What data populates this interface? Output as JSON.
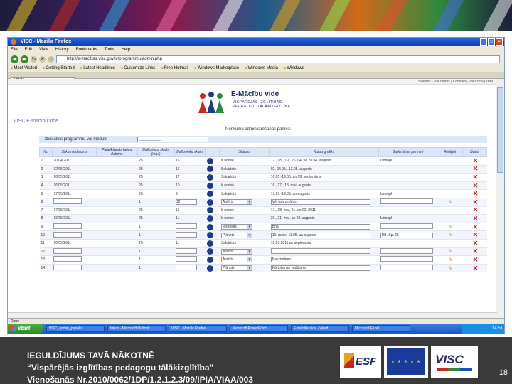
{
  "browser": {
    "window_title": "VISC - Mozilla Firefox",
    "menu": [
      "File",
      "Edit",
      "View",
      "History",
      "Bookmarks",
      "Tools",
      "Help"
    ],
    "url": "http://e-macibas.visc.gov.lv/programmu-admin.php",
    "bookmarks": [
      "Most Visited",
      "Getting Started",
      "Latest Headlines",
      "Customize Links",
      "Free Hotmail",
      "Windows Marketplace",
      "Windows Media",
      "Windows"
    ],
    "tab_label": "VISC",
    "status": "Done"
  },
  "page": {
    "site_nav": "Sākums | Par mums | Kontakti | Palīdzība | Iziet",
    "logo_title": "E-Mācību vide",
    "logo_subtitle_1": "VISPĀRĒJĀS IZGLĪTĪBAS",
    "logo_subtitle_2": "PEDAGOGU TĀLĀKIZGLĪTĪBA",
    "breadcrumb": "VISC E-mācību vide",
    "panel_title": "Norikumu administrēšanas panelis",
    "select_label": "Izvēlaties programmu vai moduli:",
    "select_value": "___________"
  },
  "table": {
    "headers": [
      "Nr.",
      "Sākuma datums",
      "Pieteikšanās beigu datums",
      "Dalībnieku skaits (max)",
      "Dalībnieku skaits",
      "",
      "Statuss",
      "Kursu grafiks",
      "Sadarbības partneri",
      "Rediģēt",
      "Dzēst"
    ],
    "rows": [
      {
        "nr": "1",
        "start": "20/04/2011",
        "deadline": "",
        "max": "25",
        "count": "16",
        "status": "Ir norisē",
        "schedule": "17., 18., 19., 26. 04. un 28.04. augusts",
        "partner": "Lmnopl",
        "edit": false
      },
      {
        "nr": "2",
        "start": "02/05/2011",
        "deadline": "",
        "max": "25",
        "count": "16",
        "status": "Sakārtots",
        "schedule": "02.-04.05., 12.05. augusts",
        "partner": "",
        "edit": false
      },
      {
        "nr": "3",
        "start": "16/05/2011",
        "deadline": "",
        "max": "25",
        "count": "17",
        "status": "Sakārtots",
        "schedule": "16.05.-19.05. un 18. septembris",
        "partner": "",
        "edit": false
      },
      {
        "nr": "4",
        "start": "16/05/2011",
        "deadline": "",
        "max": "25",
        "count": "10",
        "status": "Ir norisē",
        "schedule": "16., 17., 18. mai. augusts",
        "partner": "",
        "edit": false
      },
      {
        "nr": "5",
        "start": "17/05/2011",
        "deadline": "",
        "max": "25",
        "count": "9",
        "status": "Sakārtots",
        "schedule": "17.05.-19.05. un augusts",
        "partner": "Lmnopl",
        "edit": false
      },
      {
        "nr": "6",
        "start": "",
        "deadline": "",
        "max": "1",
        "count": "12",
        "status": "Atvērts",
        "schedule": "Vēl nav zināms",
        "partner": "",
        "edit": true
      },
      {
        "nr": "7",
        "start": "17/05/2011",
        "deadline": "",
        "max": "25",
        "count": "16",
        "status": "Ir norisē",
        "schedule": "17., 18. mai, 01. un 02. 2011",
        "partner": "",
        "edit": false
      },
      {
        "nr": "8",
        "start": "16/05/2011",
        "deadline": "",
        "max": "25",
        "count": "11",
        "status": "Ir norisē",
        "schedule": "20., 21. mai. un 22. augusts",
        "partner": "Lmnopl",
        "edit": false
      },
      {
        "nr": "9",
        "start": "",
        "deadline": "",
        "max": "17",
        "count": "",
        "status": "Iesniegts",
        "schedule": "Bņa",
        "partner": "",
        "edit": true
      },
      {
        "nr": "10",
        "start": "",
        "deadline": "",
        "max": "1",
        "count": "",
        "status": "Plānots",
        "schedule": "10. maijs, 11.05. un augusts",
        "partner": "DB. Sp. 65",
        "edit": true
      },
      {
        "nr": "11",
        "start": "16/05/2011",
        "deadline": "",
        "max": "25",
        "count": "11",
        "status": "Sakārtots",
        "schedule": "16.05.2011 un septembris",
        "partner": "",
        "edit": false
      },
      {
        "nr": "12",
        "start": "",
        "deadline": "",
        "max": "1",
        "count": "",
        "status": "Atvērts",
        "schedule": "",
        "partner": "",
        "edit": true
      },
      {
        "nr": "13",
        "start": "",
        "deadline": "",
        "max": "1",
        "count": "",
        "status": "Atvērts",
        "schedule": "Nav zināms",
        "partner": "",
        "edit": true
      },
      {
        "nr": "14",
        "start": "",
        "deadline": "",
        "max": "1",
        "count": "",
        "status": "Plānots",
        "schedule": "Kārtošanas vadīšana",
        "partner": "",
        "edit": true
      }
    ]
  },
  "taskbar": {
    "start": "start",
    "items": [
      "VISC_admin_panelis",
      "Inbox - Microsoft Outlook",
      "VISC - Mozilla Firefox",
      "Microsoft PowerPoint",
      "E-mācību vide - Word",
      "Microsoft Excel"
    ],
    "clock": "14:51"
  },
  "footer": {
    "line1": "IEGULDĪJUMS TAVĀ NĀKOTNĒ",
    "line2": "“Vispārējās izglītības pedagogu tālākizglītība”",
    "line3": "Vienošanās Nr.2010/0062/1DP/1.2.1.2.3/09/IPIA/VIAA/003",
    "esf_label": "ESF",
    "eu_label": "★ ★ ★ ★ ★",
    "visc_label": "VISC",
    "page_number": "18"
  }
}
